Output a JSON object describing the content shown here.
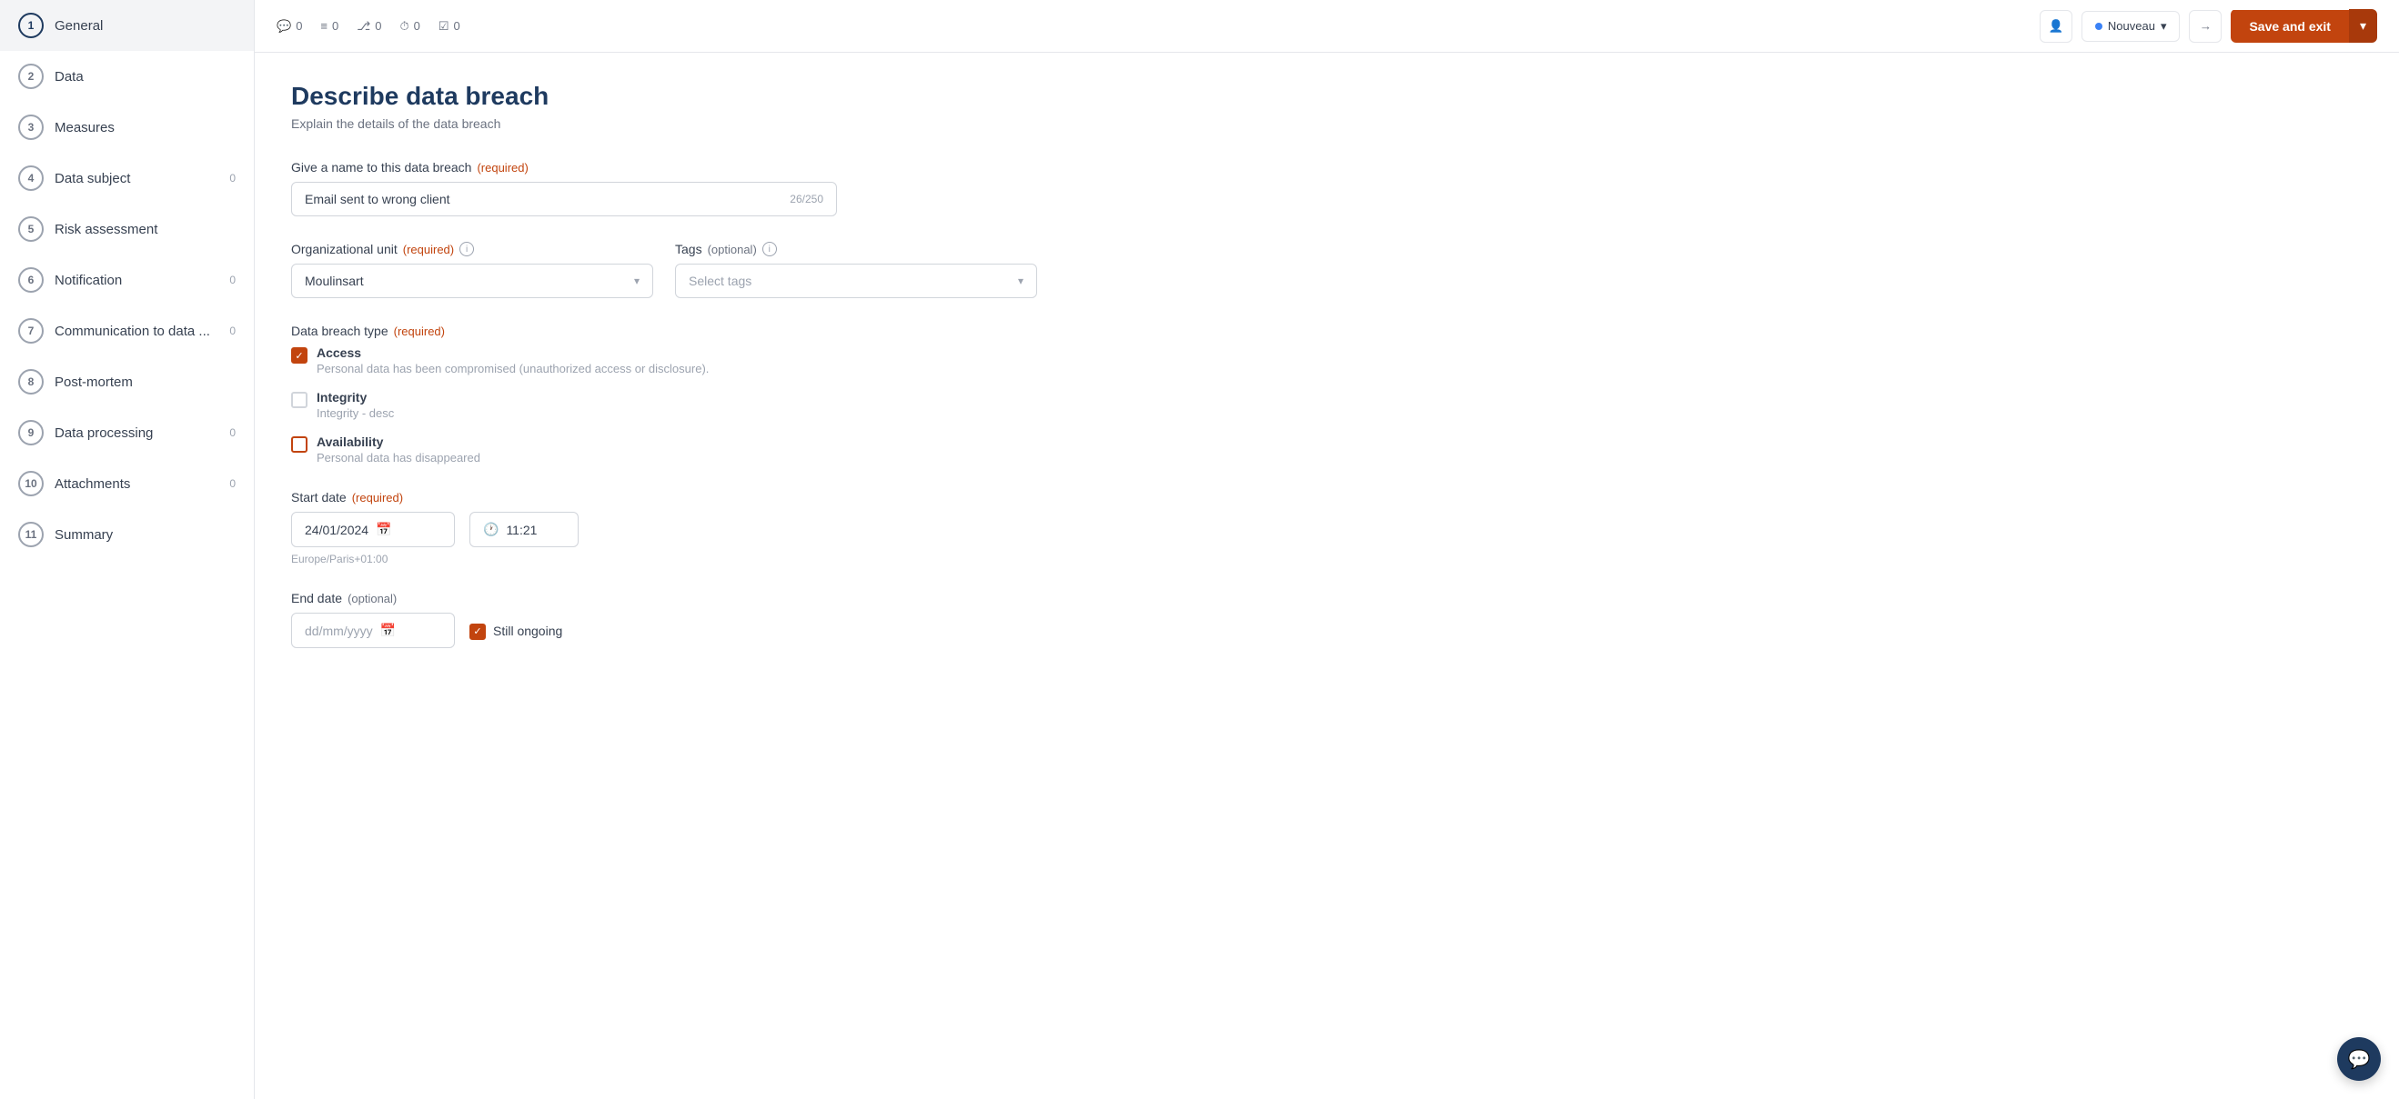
{
  "sidebar": {
    "items": [
      {
        "id": 1,
        "label": "General",
        "active": true,
        "badge": null
      },
      {
        "id": 2,
        "label": "Data",
        "active": false,
        "badge": null
      },
      {
        "id": 3,
        "label": "Measures",
        "active": false,
        "badge": null
      },
      {
        "id": 4,
        "label": "Data subject",
        "active": false,
        "badge": "0"
      },
      {
        "id": 5,
        "label": "Risk assessment",
        "active": false,
        "badge": null
      },
      {
        "id": 6,
        "label": "Notification",
        "active": false,
        "badge": "0"
      },
      {
        "id": 7,
        "label": "Communication to data ...",
        "active": false,
        "badge": "0"
      },
      {
        "id": 8,
        "label": "Post-mortem",
        "active": false,
        "badge": null
      },
      {
        "id": 9,
        "label": "Data processing",
        "active": false,
        "badge": "0"
      },
      {
        "id": 10,
        "label": "Attachments",
        "active": false,
        "badge": "0"
      },
      {
        "id": 11,
        "label": "Summary",
        "active": false,
        "badge": null
      }
    ]
  },
  "topbar": {
    "comment_count": "0",
    "list_count": "0",
    "branch_count": "0",
    "clock_count": "0",
    "check_count": "0",
    "status_label": "Nouveau",
    "save_exit_label": "Save and exit"
  },
  "form": {
    "page_title": "Describe data breach",
    "page_subtitle": "Explain the details of the data breach",
    "name_label": "Give a name to this data breach",
    "name_required": "(required)",
    "name_value": "Email sent to wrong client",
    "name_char_count": "26/250",
    "org_unit_label": "Organizational unit",
    "org_unit_required": "(required)",
    "org_unit_value": "Moulinsart",
    "tags_label": "Tags",
    "tags_optional": "(optional)",
    "tags_placeholder": "Select tags",
    "breach_type_label": "Data breach type",
    "breach_type_required": "(required)",
    "breach_types": [
      {
        "id": "access",
        "label": "Access",
        "desc": "Personal data has been compromised (unauthorized access or disclosure).",
        "checked": true,
        "indeterminate": false
      },
      {
        "id": "integrity",
        "label": "Integrity",
        "desc": "Integrity - desc",
        "checked": false,
        "indeterminate": false
      },
      {
        "id": "availability",
        "label": "Availability",
        "desc": "Personal data has disappeared",
        "checked": false,
        "indeterminate": true
      }
    ],
    "start_date_label": "Start date",
    "start_date_required": "(required)",
    "start_date_value": "24/01/2024",
    "start_time_value": "11:21",
    "timezone_label": "Europe/Paris+01:00",
    "end_date_label": "End date",
    "end_date_optional": "(optional)",
    "still_ongoing_label": "Still ongoing"
  }
}
